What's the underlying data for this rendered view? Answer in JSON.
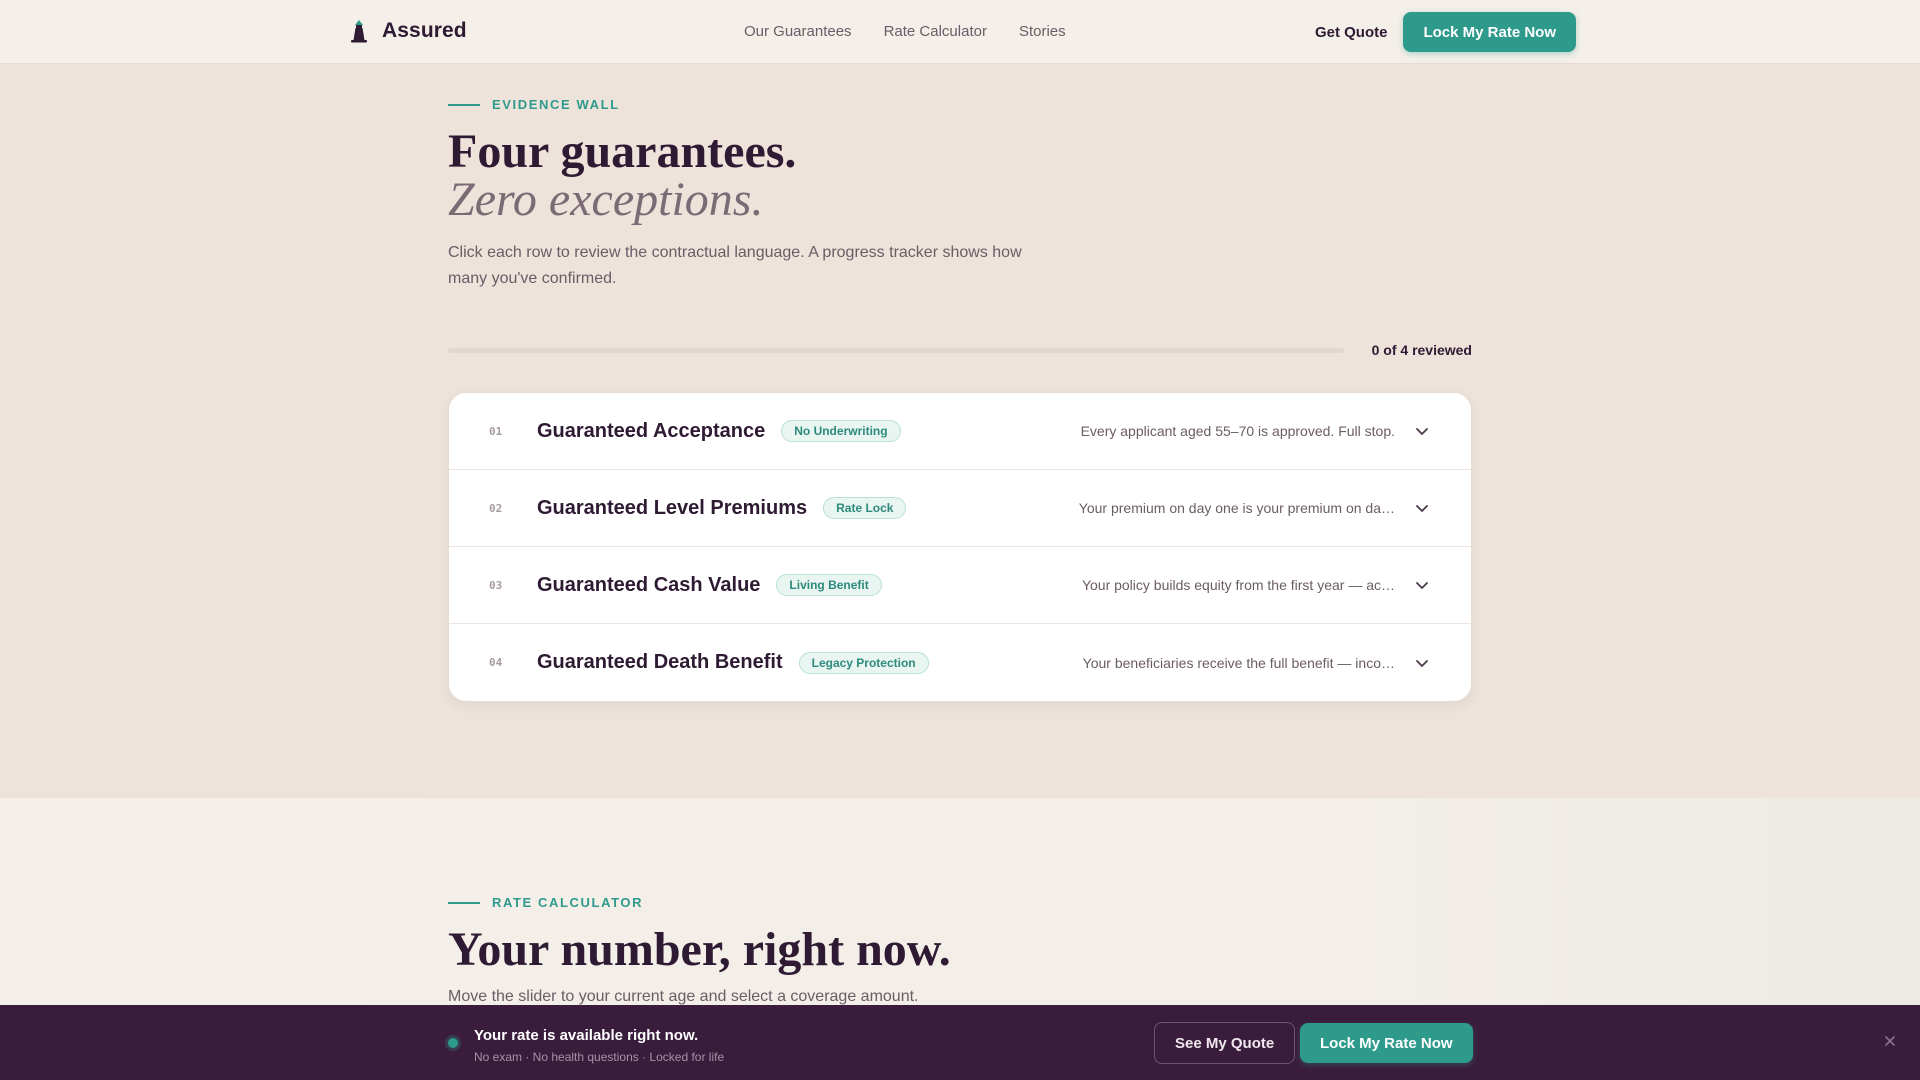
{
  "nav": {
    "brand": "Assured",
    "links": [
      "Our Guarantees",
      "Rate Calculator",
      "Stories"
    ],
    "get_quote": "Get Quote",
    "cta": "Lock My Rate Now"
  },
  "evidence": {
    "eyebrow": "EVIDENCE WALL",
    "title": "Four guarantees.",
    "title_italic": "Zero exceptions.",
    "lede": "Click each row to review the contractual language. A progress tracker shows how many you've confirmed.",
    "progress": {
      "reviewed": 0,
      "total": 4,
      "label": "0 of 4 reviewed"
    },
    "rows": [
      {
        "num": "01",
        "title": "Guaranteed Acceptance",
        "pill": "No Underwriting",
        "summary": "Every applicant aged 55–70 is approved. Full stop."
      },
      {
        "num": "02",
        "title": "Guaranteed Level Premiums",
        "pill": "Rate Lock",
        "summary": "Your premium on day one is your premium on da…"
      },
      {
        "num": "03",
        "title": "Guaranteed Cash Value",
        "pill": "Living Benefit",
        "summary": "Your policy builds equity from the first year — ac…"
      },
      {
        "num": "04",
        "title": "Guaranteed Death Benefit",
        "pill": "Legacy Protection",
        "summary": "Your beneficiaries receive the full benefit — inco…"
      }
    ]
  },
  "calculator": {
    "eyebrow": "RATE CALCULATOR",
    "title": "Your number, right now.",
    "lede": "Move the slider to your current age and select a coverage amount."
  },
  "sticky": {
    "title": "Your rate is available right now.",
    "subtitle": "No exam · No health questions · Locked for life",
    "secondary": "See My Quote",
    "primary": "Lock My Rate Now"
  },
  "colors": {
    "accent": "#2e9a8c",
    "ink": "#2e1a32",
    "sticky_bg": "#3a1d3c",
    "page_bg": "#ede3da"
  },
  "icons": [
    "lighthouse-logo-icon",
    "chevron-down-icon",
    "close-icon"
  ]
}
